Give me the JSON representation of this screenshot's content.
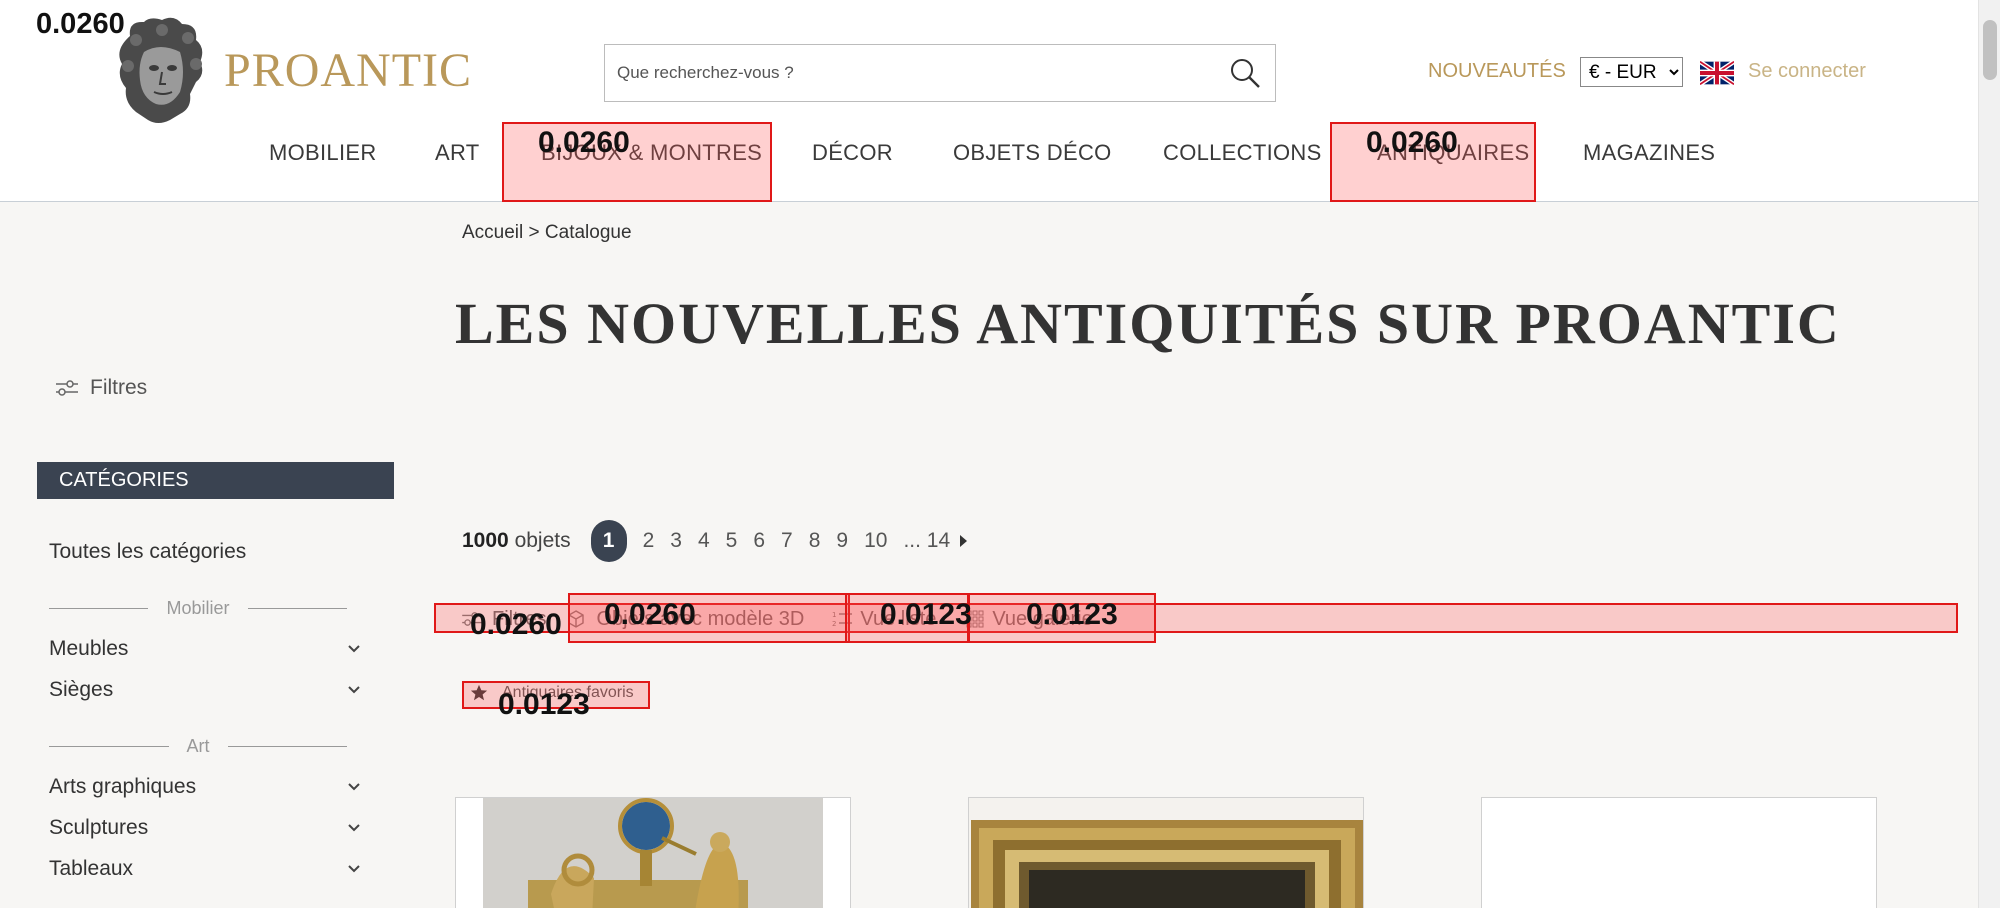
{
  "header": {
    "logo_text": "PROANTIC",
    "search_placeholder": "Que recherchez-vous ?",
    "nouveautes": "NOUVEAUTÉS",
    "currency": "€ - EUR",
    "login": "Se connecter"
  },
  "nav": [
    "MOBILIER",
    "ART",
    "BIJOUX & MONTRES",
    "DÉCOR",
    "OBJETS DÉCO",
    "COLLECTIONS",
    "ANTIQUAIRES",
    "MAGAZINES"
  ],
  "breadcrumb": "Accueil > Catalogue",
  "page_title": "LES NOUVELLES ANTIQUITÉS SUR PROANTIC",
  "filters_label": "Filtres",
  "sidebar": {
    "header": "CATÉGORIES",
    "all": "Toutes les catégories",
    "groups": [
      {
        "label": "Mobilier",
        "items": [
          "Meubles",
          "Sièges"
        ]
      },
      {
        "label": "Art",
        "items": [
          "Arts graphiques",
          "Sculptures",
          "Tableaux"
        ]
      }
    ]
  },
  "pagination": {
    "count": "1000",
    "count_label": "objets",
    "active": "1",
    "pages": [
      "2",
      "3",
      "4",
      "5",
      "6",
      "7",
      "8",
      "9",
      "10"
    ],
    "ellipsis": "... 14"
  },
  "toolbar": {
    "filters": "Filtres",
    "model3d": "Objets avec modèle 3D",
    "list": "Vue liste",
    "gallery": "Vue galerie"
  },
  "favorites": "Antiquaires favoris",
  "overlay_labels": {
    "corner": "0.0260",
    "nav_bijoux": "0.0260",
    "nav_antiquaires": "0.0260",
    "filters": "0.0260",
    "model3d": "0.0260",
    "list": "0.0123",
    "gallery": "0.0123",
    "favorites": "0.0123"
  },
  "colors": {
    "brand_gold": "#b9985a",
    "dark_slate": "#3a4351",
    "highlight_red": "#e01818"
  }
}
